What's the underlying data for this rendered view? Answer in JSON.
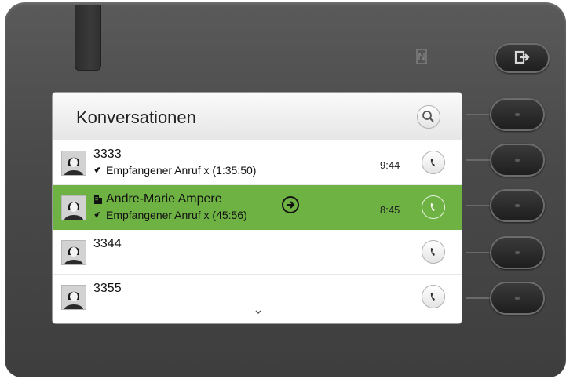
{
  "header": {
    "title": "Konversationen"
  },
  "conversations": [
    {
      "name": "3333",
      "detail": "Empfangener Anruf x (1:35:50)",
      "time": "9:44",
      "selected": false
    },
    {
      "name": "Andre-Marie Ampere",
      "detail": "Empfangener Anruf x (45:56)",
      "time": "8:45",
      "selected": true
    },
    {
      "name": "3344",
      "detail": "",
      "time": "",
      "selected": false
    },
    {
      "name": "3355",
      "detail": "",
      "time": "",
      "selected": false
    }
  ],
  "icons": {
    "search": "search-icon",
    "phone": "phone-icon",
    "incoming": "incoming-call-icon",
    "company": "building-icon",
    "forward": "arrow-right-icon",
    "more": "chevron-down-icon",
    "exit": "exit-icon",
    "nfc": "nfc-icon"
  },
  "colors": {
    "selected_row": "#6fb244",
    "device_body": "#4a4a4a"
  }
}
